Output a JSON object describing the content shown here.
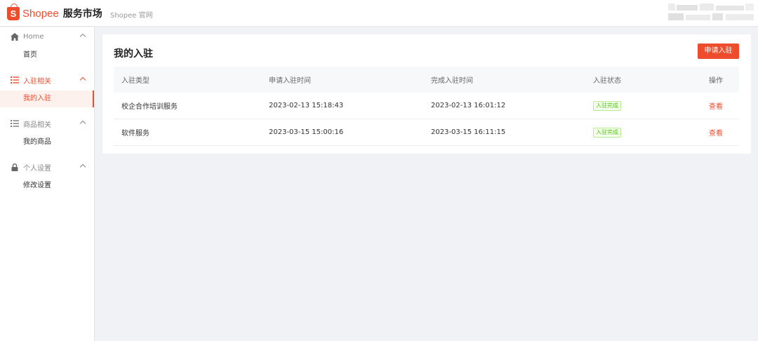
{
  "header": {
    "logo_letter": "S",
    "brand": "Shopee",
    "market": "服务市场",
    "official_link": "Shopee 官网"
  },
  "sidebar": {
    "groups": [
      {
        "label": "Home",
        "icon": "home-icon",
        "items": [
          {
            "label": "首页"
          }
        ]
      },
      {
        "label": "入驻相关",
        "icon": "list-icon",
        "items": [
          {
            "label": "我的入驻"
          }
        ]
      },
      {
        "label": "商品相关",
        "icon": "list-icon",
        "items": [
          {
            "label": "我的商品"
          }
        ]
      },
      {
        "label": "个人设置",
        "icon": "lock-icon",
        "items": [
          {
            "label": "修改设置"
          }
        ]
      }
    ],
    "active_group": "入驻相关",
    "active_item": "我的入驻"
  },
  "main": {
    "title": "我的入驻",
    "apply_button": "申请入驻",
    "table": {
      "columns": [
        "入驻类型",
        "申请入驻时间",
        "完成入驻时间",
        "入驻状态",
        "操作"
      ],
      "rows": [
        {
          "type": "校企合作培训服务",
          "apply_time": "2023-02-13 15:18:43",
          "complete_time": "2023-02-13 16:01:12",
          "status": "入驻完成",
          "action": "查看"
        },
        {
          "type": "软件服务",
          "apply_time": "2023-03-15 15:00:16",
          "complete_time": "2023-03-15 16:11:15",
          "status": "入驻完成",
          "action": "查看"
        }
      ]
    }
  },
  "colors": {
    "accent": "#ee4d2d",
    "status_green": "#52c41a",
    "background": "#f0f2f5"
  }
}
